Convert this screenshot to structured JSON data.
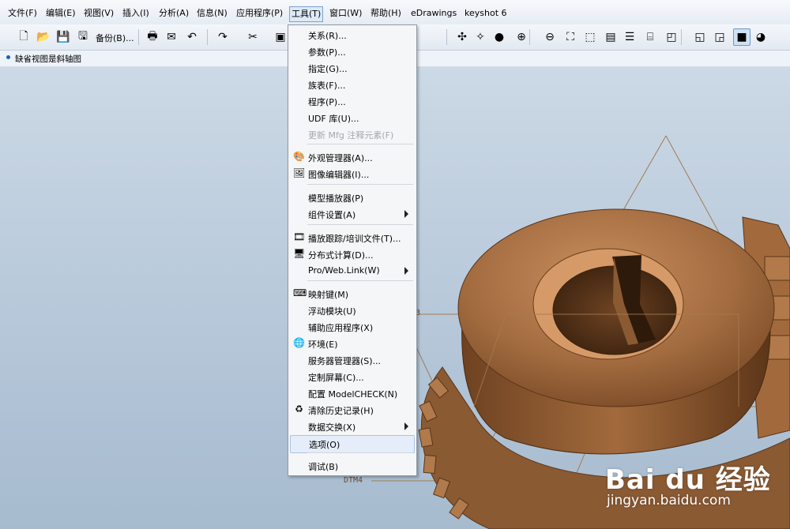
{
  "menubar": {
    "items": [
      "文件(F)",
      "编辑(E)",
      "视图(V)",
      "插入(I)",
      "分析(A)",
      "信息(N)",
      "应用程序(P)",
      "工具(T)",
      "窗口(W)",
      "帮助(H)",
      "eDrawings",
      "keyshot 6"
    ],
    "active_item": "工具(T)"
  },
  "toolbar": {
    "backup_label": "备份(B)...",
    "icons": [
      "new-file-icon",
      "open-folder-icon",
      "save-icon",
      "save-as-icon",
      "print-icon",
      "send-mail-icon",
      "undo-icon",
      "redo-icon",
      "cut-icon",
      "repaint-icon",
      "spin-center-icon",
      "orient-icon",
      "shading-icon",
      "zoom-in-icon",
      "zoom-out-icon",
      "refit-icon",
      "view-manager-icon",
      "saved-views-icon",
      "layers-icon",
      "model-tree-icon",
      "wireframe-icon",
      "hidden-line-icon",
      "no-hidden-icon",
      "shaded-icon",
      "appearance-icon"
    ]
  },
  "hint": {
    "text": "缺省视图是斜轴图"
  },
  "tools_menu": {
    "items": [
      {
        "label": "关系(R)...",
        "icon": "",
        "disabled": false,
        "submenu": false
      },
      {
        "label": "参数(P)...",
        "icon": "",
        "disabled": false,
        "submenu": false
      },
      {
        "label": "指定(G)...",
        "icon": "",
        "disabled": false,
        "submenu": false
      },
      {
        "label": "族表(F)...",
        "icon": "",
        "disabled": false,
        "submenu": false
      },
      {
        "label": "程序(P)...",
        "icon": "",
        "disabled": false,
        "submenu": false
      },
      {
        "label": "UDF 库(U)...",
        "icon": "",
        "disabled": false,
        "submenu": false
      },
      {
        "label": "更新 Mfg 注释元素(F)",
        "icon": "",
        "disabled": true,
        "submenu": false
      },
      {
        "label": "外观管理器(A)...",
        "icon": "appearance-manager-icon",
        "disabled": false,
        "submenu": false
      },
      {
        "label": "图像编辑器(I)...",
        "icon": "image-editor-icon",
        "disabled": false,
        "submenu": false
      },
      {
        "label": "模型播放器(P)",
        "icon": "",
        "disabled": false,
        "submenu": false
      },
      {
        "label": "组件设置(A)",
        "icon": "",
        "disabled": false,
        "submenu": true
      },
      {
        "label": "播放跟踪/培训文件(T)...",
        "icon": "playback-trail-icon",
        "disabled": false,
        "submenu": false
      },
      {
        "label": "分布式计算(D)...",
        "icon": "distributed-computing-icon",
        "disabled": false,
        "submenu": false
      },
      {
        "label": "Pro/Web.Link(W)",
        "icon": "",
        "disabled": false,
        "submenu": true
      },
      {
        "label": "映射键(M)",
        "icon": "mapkey-icon",
        "disabled": false,
        "submenu": false
      },
      {
        "label": "浮动模块(U)",
        "icon": "",
        "disabled": false,
        "submenu": false
      },
      {
        "label": "辅助应用程序(X)",
        "icon": "",
        "disabled": false,
        "submenu": false
      },
      {
        "label": "环境(E)",
        "icon": "environment-icon",
        "disabled": false,
        "submenu": false
      },
      {
        "label": "服务器管理器(S)...",
        "icon": "",
        "disabled": false,
        "submenu": false
      },
      {
        "label": "定制屏幕(C)...",
        "icon": "",
        "disabled": false,
        "submenu": false
      },
      {
        "label": "配置 ModelCHECK(N)",
        "icon": "",
        "disabled": false,
        "submenu": false
      },
      {
        "label": "清除历史记录(H)",
        "icon": "clear-history-icon",
        "disabled": false,
        "submenu": false
      },
      {
        "label": "数据交换(X)",
        "icon": "",
        "disabled": false,
        "submenu": true
      },
      {
        "label": "选项(O)",
        "icon": "",
        "disabled": false,
        "submenu": false,
        "highlighted": true
      },
      {
        "label": "调试(B)",
        "icon": "",
        "disabled": false,
        "submenu": false
      }
    ]
  },
  "datums": {
    "dtm4": "DTM4",
    "partial": "3"
  },
  "watermark": {
    "brand": "Bai du 经验",
    "url": "jingyan.baidu.com"
  },
  "colors": {
    "gear_main": "#9a643a",
    "gear_dark": "#5c3518",
    "gear_light": "#c88e5e",
    "datum_line": "#a37b50",
    "menu_bg": "#f5f6f7"
  }
}
